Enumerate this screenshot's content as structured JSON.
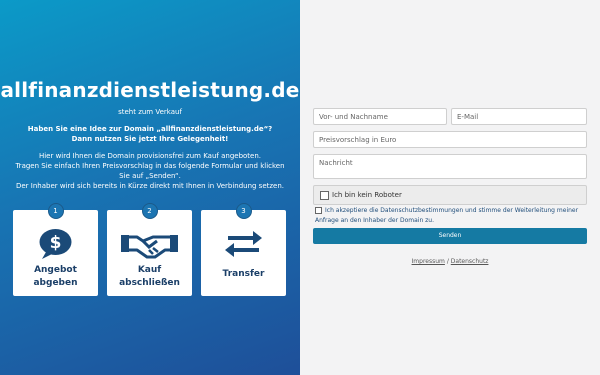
{
  "left": {
    "domain": "allfinanzdienstleistung.de",
    "status": "steht zum Verkauf",
    "headline_1": "Haben Sie eine Idee zur Domain „allfinanzdienstleistung.de“?",
    "headline_2": "Dann nutzen Sie jetzt Ihre Gelegenheit!",
    "desc_1": "Hier wird Ihnen die Domain provisionsfrei zum Kauf angeboten.",
    "desc_2": "Tragen Sie einfach Ihren Preisvorschlag in das folgende Formular und klicken Sie auf „Senden“.",
    "desc_3": "Der Inhaber wird sich bereits in Kürze direkt mit Ihnen in Verbindung setzen.",
    "steps": [
      {
        "num": "1",
        "line1": "Angebot",
        "line2": "abgeben",
        "icon": "money-chat-icon"
      },
      {
        "num": "2",
        "line1": "Kauf",
        "line2": "abschließen",
        "icon": "handshake-icon"
      },
      {
        "num": "3",
        "line1": "Transfer",
        "line2": "",
        "icon": "transfer-arrows-icon"
      }
    ]
  },
  "form": {
    "name_placeholder": "Vor- und Nachname",
    "email_placeholder": "E-Mail",
    "price_placeholder": "Preisvorschlag in Euro",
    "message_placeholder": "Nachricht",
    "robot_label": "Ich bin kein Roboter",
    "consent_text": "Ich akzeptiere die Datenschutzbestimmungen und stimme der Weiterleitung meiner Anfrage an den Inhaber der Domain zu.",
    "submit_label": "Senden"
  },
  "footer": {
    "impressum": "Impressum",
    "separator": "/",
    "datenschutz": "Datenschutz"
  },
  "colors": {
    "gradient_top": "#0b9ac8",
    "gradient_bottom": "#1e4f99",
    "button": "#157aa3",
    "icon": "#1b4a78"
  }
}
